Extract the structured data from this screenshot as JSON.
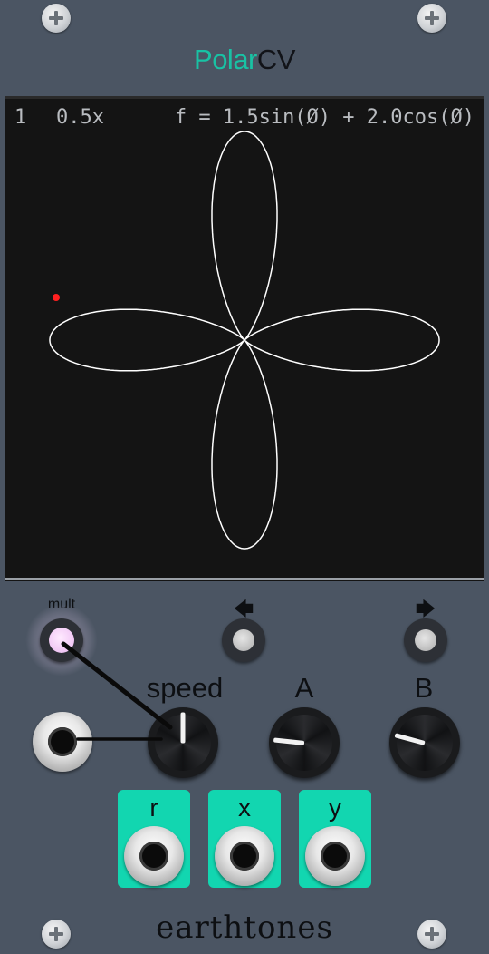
{
  "colors": {
    "accent": "#19c2a4",
    "output_box": "#12d6b0",
    "cable": "#0a0a0a"
  },
  "module": {
    "title_part1": "Polar",
    "title_part2": "CV",
    "brand": "earthtones"
  },
  "display": {
    "index": "1",
    "multiplier": "0.5x",
    "formula": "f = 1.5sin(Ø) + 2.0cos(Ø)"
  },
  "controls": {
    "mult_label": "mult",
    "prev_icon": "left-arrow-icon",
    "next_icon": "right-arrow-icon",
    "prev_glyph": "🡄",
    "next_glyph": "🡆",
    "speed_label": "speed",
    "a_label": "A",
    "b_label": "B"
  },
  "knob_values": {
    "speed": 0.5,
    "a": 0.22,
    "b": 0.25
  },
  "outputs": [
    {
      "label": "r"
    },
    {
      "label": "x"
    },
    {
      "label": "y"
    }
  ]
}
